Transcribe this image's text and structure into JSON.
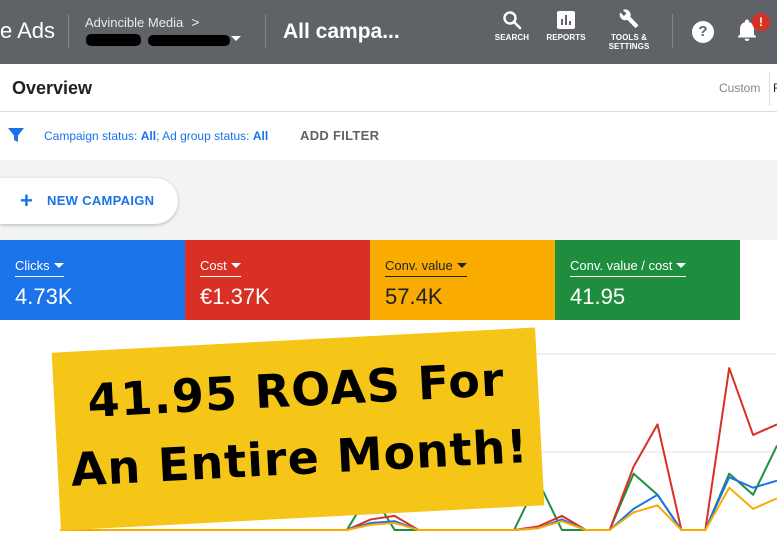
{
  "header": {
    "brand": "e Ads",
    "account": {
      "name": "Advincible Media",
      "chevron": ">"
    },
    "page_heading": "All campa...",
    "tools": [
      {
        "label": "SEARCH",
        "icon": "search-icon"
      },
      {
        "label": "REPORTS",
        "icon": "reports-icon"
      },
      {
        "label_line1": "TOOLS &",
        "label_line2": "SETTINGS",
        "icon": "wrench-icon"
      }
    ],
    "help_glyph": "?",
    "notification_badge": "!"
  },
  "overview": {
    "title": "Overview",
    "date_range_label": "Custom",
    "date_range_value": "F"
  },
  "filters": {
    "campaign_status_label": "Campaign status: ",
    "campaign_status_value": "All",
    "separator": "; ",
    "ad_group_status_label": "Ad group status: ",
    "ad_group_status_value": "All",
    "add_filter": "ADD FILTER"
  },
  "actions": {
    "new_campaign": "NEW CAMPAIGN"
  },
  "metrics": [
    {
      "label": "Clicks",
      "value": "4.73K",
      "color": "#1a73e8",
      "text_color": "#ffffff"
    },
    {
      "label": "Cost",
      "value": "€1.37K",
      "color": "#d93025",
      "text_color": "#ffffff"
    },
    {
      "label": "Conv. value",
      "value": "57.4K",
      "color": "#f9ab00",
      "text_color": "#202124"
    },
    {
      "label": "Conv. value / cost",
      "value": "41.95",
      "color": "#1e8e3e",
      "text_color": "#ffffff"
    }
  ],
  "banner": {
    "line1": "41.95 ROAS For",
    "line2": "An Entire Month!"
  },
  "chart_data": {
    "type": "line",
    "x": [
      0,
      1,
      2,
      3,
      4,
      5,
      6,
      7,
      8,
      9,
      10,
      11,
      12,
      13,
      14,
      15,
      16,
      17,
      18,
      19,
      20,
      21,
      22,
      23,
      24,
      25,
      26,
      27,
      28,
      29,
      30
    ],
    "series": [
      {
        "color": "#1e8e3e",
        "values": [
          0,
          0,
          0,
          0,
          0,
          0,
          0,
          0,
          0,
          0,
          0,
          0,
          0,
          22,
          0,
          0,
          0,
          0,
          0,
          0,
          28,
          0,
          0,
          0,
          32,
          20,
          0,
          0,
          32,
          20,
          48
        ]
      },
      {
        "color": "#d93025",
        "values": [
          0,
          0,
          0,
          0,
          0,
          0,
          0,
          0,
          0,
          0,
          0,
          0,
          0,
          6,
          8,
          0,
          0,
          0,
          0,
          0,
          2,
          8,
          0,
          0,
          36,
          60,
          0,
          0,
          92,
          54,
          60
        ]
      },
      {
        "color": "#1a73e8",
        "values": [
          0,
          0,
          0,
          0,
          0,
          0,
          0,
          0,
          0,
          0,
          0,
          0,
          0,
          4,
          5,
          0,
          0,
          0,
          0,
          0,
          1,
          6,
          0,
          0,
          12,
          20,
          0,
          0,
          30,
          24,
          28
        ]
      },
      {
        "color": "#f9ab00",
        "values": [
          0,
          0,
          0,
          0,
          0,
          0,
          0,
          0,
          0,
          0,
          0,
          0,
          0,
          3,
          4,
          0,
          0,
          0,
          0,
          0,
          1,
          5,
          0,
          0,
          10,
          14,
          0,
          0,
          24,
          12,
          18
        ]
      }
    ],
    "ylim": [
      0,
      100
    ],
    "grid": true,
    "legend": "none"
  }
}
